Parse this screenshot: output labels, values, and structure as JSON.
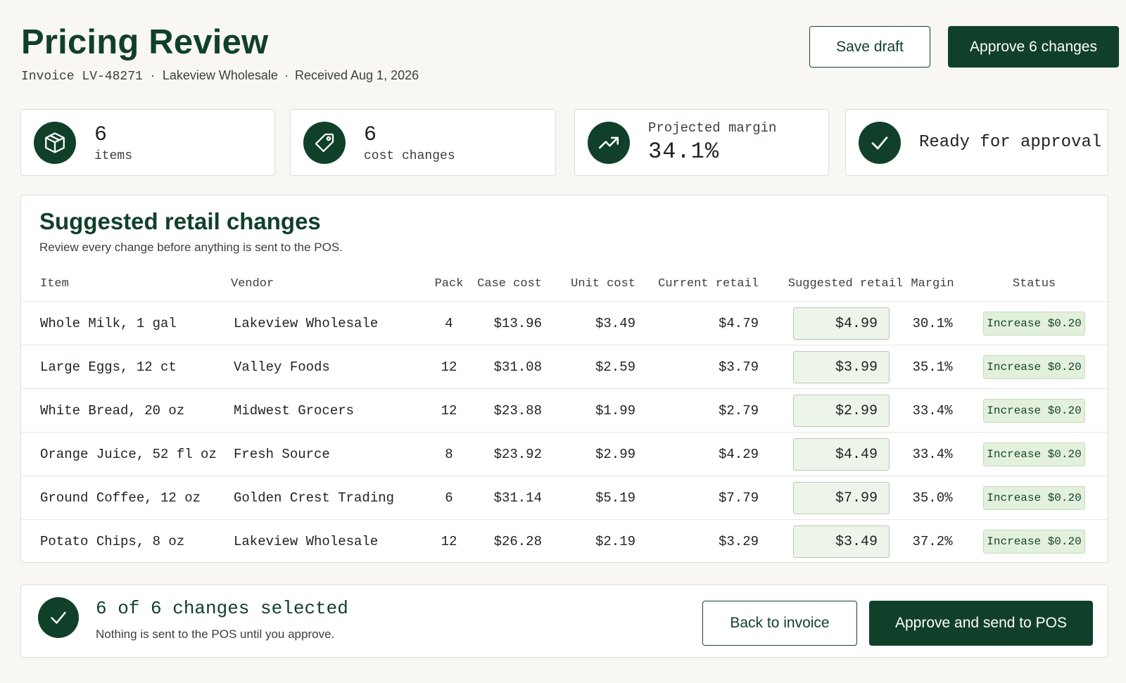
{
  "header": {
    "title": "Pricing Review",
    "invoice": "Invoice LV-48271",
    "vendor": "Lakeview Wholesale",
    "received": "Received Aug 1, 2026",
    "separator": "·",
    "save_draft_label": "Save draft",
    "approve_label": "Approve 6 changes"
  },
  "stats": {
    "items": {
      "value": "6",
      "label": "items",
      "icon": "box-icon"
    },
    "cost_changes": {
      "value": "6",
      "label": "cost changes",
      "icon": "tag-icon"
    },
    "margin": {
      "caption": "Projected margin",
      "value": "34.1%",
      "icon": "trend-up-icon"
    },
    "ready": {
      "label": "Ready for approval",
      "icon": "check-icon"
    }
  },
  "table": {
    "title": "Suggested retail changes",
    "subtitle": "Review every change before anything is sent to the POS.",
    "columns": [
      "Item",
      "Vendor",
      "Pack",
      "Case cost",
      "Unit cost",
      "Current retail",
      "Suggested retail",
      "Margin",
      "Status"
    ],
    "rows": [
      {
        "item": "Whole Milk, 1 gal",
        "vendor": "Lakeview Wholesale",
        "pack": "4",
        "case_cost": "$13.96",
        "unit_cost": "$3.49",
        "current_retail": "$4.79",
        "suggested_retail": "$4.99",
        "margin": "30.1%",
        "status": "Increase $0.20"
      },
      {
        "item": "Large Eggs, 12 ct",
        "vendor": "Valley Foods",
        "pack": "12",
        "case_cost": "$31.08",
        "unit_cost": "$2.59",
        "current_retail": "$3.79",
        "suggested_retail": "$3.99",
        "margin": "35.1%",
        "status": "Increase $0.20"
      },
      {
        "item": "White Bread, 20 oz",
        "vendor": "Midwest Grocers",
        "pack": "12",
        "case_cost": "$23.88",
        "unit_cost": "$1.99",
        "current_retail": "$2.79",
        "suggested_retail": "$2.99",
        "margin": "33.4%",
        "status": "Increase $0.20"
      },
      {
        "item": "Orange Juice, 52 fl oz",
        "vendor": "Fresh Source",
        "pack": "8",
        "case_cost": "$23.92",
        "unit_cost": "$2.99",
        "current_retail": "$4.29",
        "suggested_retail": "$4.49",
        "margin": "33.4%",
        "status": "Increase $0.20"
      },
      {
        "item": "Ground Coffee, 12 oz",
        "vendor": "Golden Crest Trading",
        "pack": "6",
        "case_cost": "$31.14",
        "unit_cost": "$5.19",
        "current_retail": "$7.79",
        "suggested_retail": "$7.99",
        "margin": "35.0%",
        "status": "Increase $0.20"
      },
      {
        "item": "Potato Chips, 8 oz",
        "vendor": "Lakeview Wholesale",
        "pack": "12",
        "case_cost": "$26.28",
        "unit_cost": "$2.19",
        "current_retail": "$3.29",
        "suggested_retail": "$3.49",
        "margin": "37.2%",
        "status": "Increase $0.20"
      }
    ]
  },
  "footer": {
    "selected": "6 of 6 changes selected",
    "note": "Nothing is sent to the POS until you approve.",
    "back_label": "Back to invoice",
    "approve_send_label": "Approve and send to POS"
  },
  "colors": {
    "accent": "#11402a",
    "badge_bg": "#e2f0dc",
    "input_bg": "#edf4ea",
    "page_bg": "#f8f7f4"
  }
}
